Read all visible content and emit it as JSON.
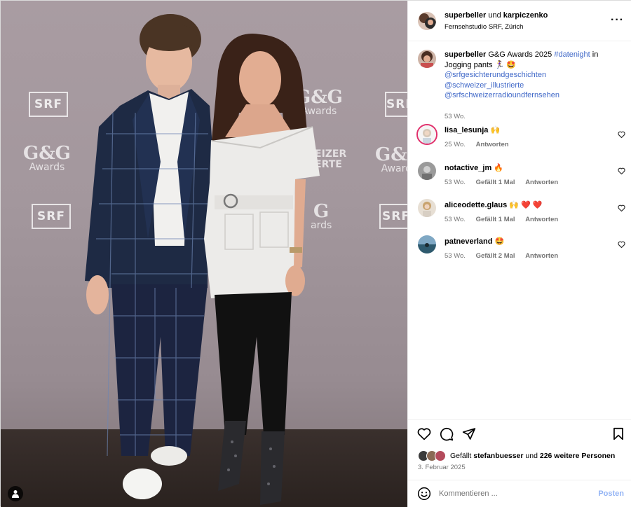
{
  "post": {
    "header": {
      "user1": "superbeller",
      "joiner": "und",
      "user2": "karpiczenko",
      "location": "Fernsehstudio SRF, Zürich",
      "more_icon": "more-horizontal-icon"
    },
    "caption": {
      "user": "superbeller",
      "text": "G&G Awards 2025",
      "hashtag": "#datenight",
      "after_hashtag": "in",
      "line2": "Jogging pants 🏃‍♀️ 🤩",
      "mentions": [
        "@srfgesichterundgeschichten",
        "@schweizer_illustrierte",
        "@srfschweizerradioundfernsehen"
      ],
      "age": "53 Wo."
    },
    "comments": [
      {
        "user": "lisa_lesunja",
        "text": "🙌",
        "age": "25 Wo.",
        "likes": "",
        "reply": "Antworten"
      },
      {
        "user": "notactive_jm",
        "text": "🔥",
        "age": "53 Wo.",
        "likes": "Gefällt 1 Mal",
        "reply": "Antworten"
      },
      {
        "user": "aliceodette.glaus",
        "text": "🙌 ❤️ ❤️",
        "age": "53 Wo.",
        "likes": "Gefällt 1 Mal",
        "reply": "Antworten"
      },
      {
        "user": "patneverland",
        "text": "🤩",
        "age": "53 Wo.",
        "likes": "Gefällt 2 Mal",
        "reply": "Antworten"
      }
    ],
    "likes": {
      "prefix": "Gefällt",
      "user": "stefanbuesser",
      "joiner": "und",
      "rest": "226 weitere Personen"
    },
    "date": "3. Februar 2025",
    "comment_box": {
      "placeholder": "Kommentieren ...",
      "post_label": "Posten"
    }
  },
  "photo": {
    "wall_logos": [
      "SRF",
      "G&G",
      "Awards",
      "SRF",
      "SRF",
      "SRF",
      "G&G",
      "Awards",
      "EIZER",
      "ERTE",
      "G",
      "ards"
    ],
    "user_tag_icon": "person-icon"
  },
  "colors": {
    "link": "#4169c8",
    "muted": "#737373",
    "post_button": "#93b4f5",
    "border": "#efefef"
  }
}
